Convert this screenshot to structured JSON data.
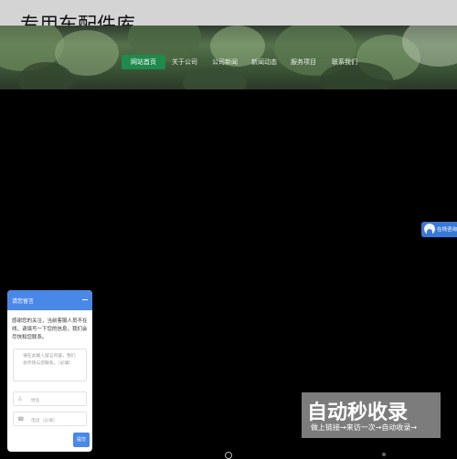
{
  "site": {
    "title": "专用车配件库"
  },
  "nav": {
    "items": [
      {
        "label": "网站首页",
        "active": true
      },
      {
        "label": "关于公司"
      },
      {
        "label": "公司新闻"
      },
      {
        "label": "新闻动态"
      },
      {
        "label": "服务项目"
      },
      {
        "label": "联系我们"
      }
    ]
  },
  "online_service": {
    "label": "在线咨询"
  },
  "chat": {
    "title": "请您留言",
    "message": "感谢您的关注，当前客服人员不在线，请填写一下您的信息，我们会尽快和您联系。",
    "textarea_placeholder": "请在此输入留言内容，我们会尽快与您联系。（必填）",
    "name_placeholder": "姓名",
    "phone_placeholder": "电话（必填）",
    "submit_label": "提交"
  },
  "watermark": {
    "logo_text": "自动秒收录",
    "sub_text": "做上链接→来访一次→自动收录→"
  },
  "colors": {
    "nav_active": "#1f8a4c",
    "chat_header": "#4a88e8"
  }
}
